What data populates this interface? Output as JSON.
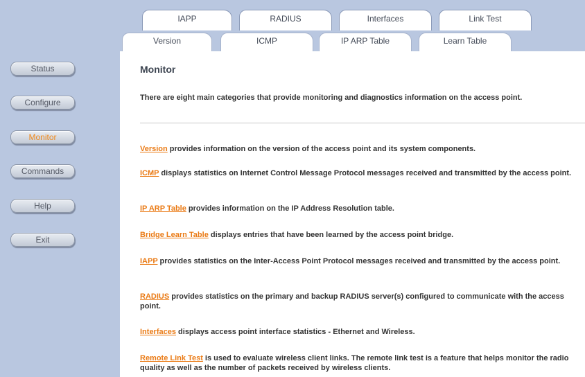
{
  "sidebar": {
    "items": [
      {
        "label": "Status"
      },
      {
        "label": "Configure"
      },
      {
        "label": "Monitor",
        "active": true
      },
      {
        "label": "Commands"
      },
      {
        "label": "Help"
      },
      {
        "label": "Exit"
      }
    ]
  },
  "tabs": {
    "row1": [
      {
        "label": "IAPP"
      },
      {
        "label": "RADIUS"
      },
      {
        "label": "Interfaces"
      },
      {
        "label": "Link Test"
      }
    ],
    "row2": [
      {
        "label": "Version"
      },
      {
        "label": "ICMP"
      },
      {
        "label": "IP ARP Table"
      },
      {
        "label": "Learn Table"
      }
    ]
  },
  "main": {
    "title": "Monitor",
    "intro": "There are eight main categories that provide monitoring and diagnostics information on the access point.",
    "items": [
      {
        "link": "Version",
        "text": " provides information on the version of the access point and its system components."
      },
      {
        "link": "ICMP",
        "text": " displays statistics on Internet Control Message Protocol messages received and transmitted by the access point."
      },
      {
        "link": "IP ARP Table",
        "text": " provides information on the IP Address Resolution table."
      },
      {
        "link": "Bridge Learn Table",
        "text": " displays entries that have been learned by the access point bridge."
      },
      {
        "link": "IAPP",
        "text": " provides statistics on the Inter-Access Point Protocol messages received and transmitted by the access point."
      },
      {
        "link": "RADIUS",
        "text": " provides statistics on the primary and backup RADIUS server(s) configured to communicate with the access point."
      },
      {
        "link": "Interfaces",
        "text": " displays access point interface statistics - Ethernet and Wireless."
      },
      {
        "link": "Remote Link Test",
        "text": " is used to evaluate wireless client links. The remote link test is a feature that helps monitor the radio quality as well as the number of packets received by wireless clients."
      }
    ]
  },
  "colors": {
    "sidebar_bg": "#b9c7e0",
    "link": "#ea7a14",
    "active_nav": "#f08a1c"
  }
}
